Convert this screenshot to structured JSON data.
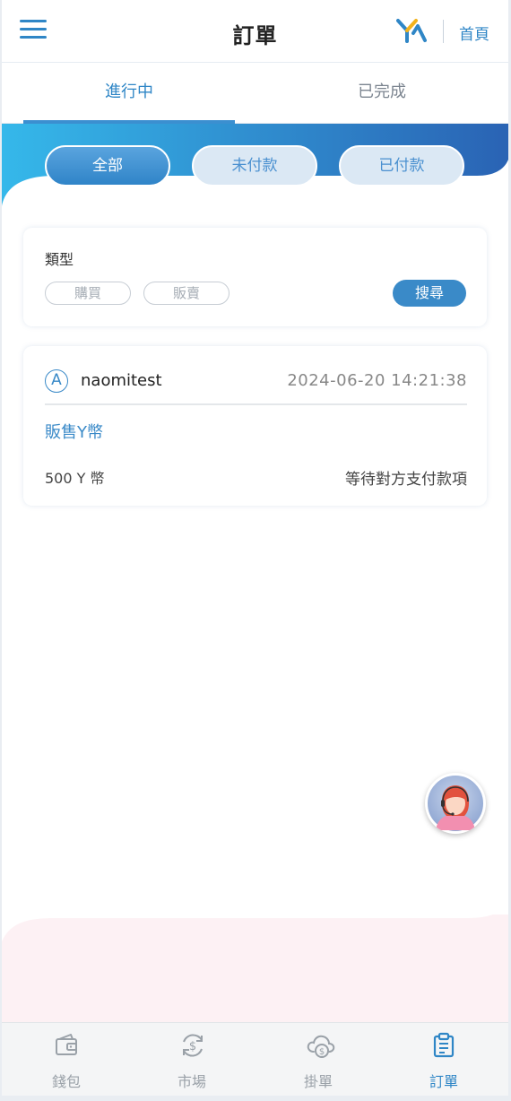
{
  "header": {
    "title": "訂單",
    "home_label": "首頁"
  },
  "tabs": [
    {
      "label": "進行中",
      "active": true
    },
    {
      "label": "已完成",
      "active": false
    }
  ],
  "status_filters": [
    {
      "label": "全部",
      "active": true
    },
    {
      "label": "未付款",
      "active": false
    },
    {
      "label": "已付款",
      "active": false
    }
  ],
  "filter": {
    "type_label": "類型",
    "options": [
      "購買",
      "販賣"
    ],
    "search_label": "搜尋"
  },
  "orders": [
    {
      "avatar_letter": "A",
      "username": "naomitest",
      "datetime": "2024-06-20 14:21:38",
      "order_type": "販售Y幣",
      "amount": "500 Y 幣",
      "status": "等待對方支付款項"
    }
  ],
  "bottom_nav": [
    {
      "label": "錢包",
      "icon": "wallet-icon",
      "active": false
    },
    {
      "label": "市場",
      "icon": "coin-exchange-icon",
      "active": false
    },
    {
      "label": "掛單",
      "icon": "cloud-dollar-icon",
      "active": false
    },
    {
      "label": "訂單",
      "icon": "clipboard-icon",
      "active": true
    }
  ],
  "colors": {
    "accent": "#2f86c6",
    "banner_start": "#35b8ea",
    "banner_end": "#2a63b4",
    "pink_area": "#fdf1f4"
  }
}
